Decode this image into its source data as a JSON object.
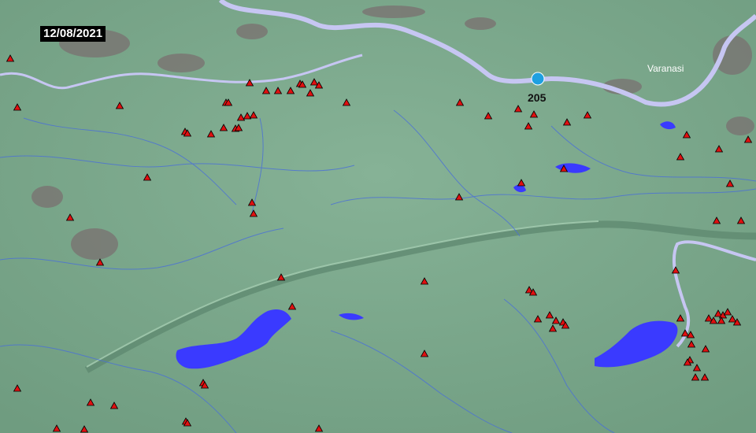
{
  "date": "12/08/2021",
  "city": {
    "name": "Varanasi"
  },
  "station": {
    "value": "205",
    "color": "#1ea0e0"
  },
  "colors": {
    "terrain": "#7aa88a",
    "river": "#c6c6f2",
    "stream": "#4a6fd8",
    "reservoir": "#3a3aff",
    "settlement": "#7a7070",
    "marker_fill": "#e01010",
    "marker_stroke": "#000000"
  },
  "markers": {
    "type": "red-triangle",
    "label": ""
  }
}
